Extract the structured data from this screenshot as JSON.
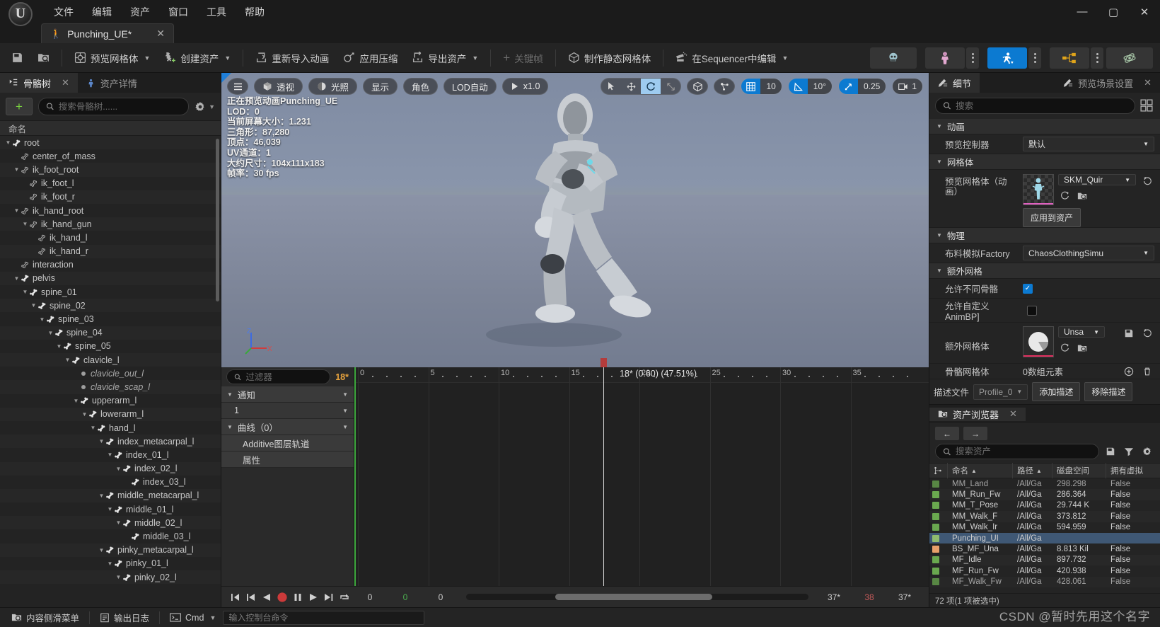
{
  "window": {
    "menus": [
      "文件",
      "编辑",
      "资产",
      "窗口",
      "工具",
      "帮助"
    ],
    "minimize": "—",
    "maximize": "▢",
    "close": "✕"
  },
  "tab": {
    "title": "Punching_UE*",
    "close": "✕"
  },
  "toolbar": {
    "save": "save-icon",
    "browse": "browse-icon",
    "items": [
      {
        "label": "预览网格体",
        "icon": "preview-mesh-icon",
        "caret": true
      },
      {
        "label": "创建资产",
        "icon": "create-asset-icon",
        "caret": true
      },
      {
        "label": "重新导入动画",
        "icon": "reimport-icon",
        "caret": false
      },
      {
        "label": "应用压缩",
        "icon": "compression-icon",
        "caret": false
      },
      {
        "label": "导出资产",
        "icon": "export-icon",
        "caret": true
      },
      {
        "label": "关键帧",
        "icon": "keyframe-icon",
        "caret": false,
        "disabled": true
      },
      {
        "label": "制作静态网格体",
        "icon": "static-mesh-icon",
        "caret": false
      },
      {
        "label": "在Sequencer中编辑",
        "icon": "sequencer-icon",
        "caret": true
      }
    ],
    "right_buttons": [
      {
        "name": "skeleton-mode-button",
        "icon": "skull-icon",
        "active": false
      },
      {
        "name": "mesh-mode-button",
        "icon": "body-icon",
        "active": false
      },
      {
        "name": "animation-mode-button",
        "icon": "runner-star-icon",
        "active": true
      },
      {
        "name": "graph-mode-button",
        "icon": "node-graph-icon",
        "active": false
      },
      {
        "name": "physics-mode-button",
        "icon": "physics-icon",
        "active": false
      }
    ]
  },
  "left_panel": {
    "tabs": [
      {
        "label": "骨骼树",
        "icon": "skeleton-tree-icon",
        "active": true,
        "close": "✕"
      },
      {
        "label": "资产详情",
        "icon": "asset-details-icon",
        "active": false
      }
    ],
    "add_button": "+",
    "search_placeholder": "搜索骨骼树......",
    "column_header": "命名",
    "tree": [
      {
        "label": "root",
        "depth": 0,
        "expand": "▼",
        "icon": "bone",
        "virtual": false
      },
      {
        "label": "center_of_mass",
        "depth": 1,
        "expand": "",
        "icon": "bone-small",
        "virtual": false
      },
      {
        "label": "ik_foot_root",
        "depth": 1,
        "expand": "▼",
        "icon": "bone-small",
        "virtual": false
      },
      {
        "label": "ik_foot_l",
        "depth": 2,
        "expand": "",
        "icon": "bone-small",
        "virtual": false
      },
      {
        "label": "ik_foot_r",
        "depth": 2,
        "expand": "",
        "icon": "bone-small",
        "virtual": false
      },
      {
        "label": "ik_hand_root",
        "depth": 1,
        "expand": "▼",
        "icon": "bone-small",
        "virtual": false
      },
      {
        "label": "ik_hand_gun",
        "depth": 2,
        "expand": "▼",
        "icon": "bone-small",
        "virtual": false
      },
      {
        "label": "ik_hand_l",
        "depth": 3,
        "expand": "",
        "icon": "bone-small",
        "virtual": false
      },
      {
        "label": "ik_hand_r",
        "depth": 3,
        "expand": "",
        "icon": "bone-small",
        "virtual": false
      },
      {
        "label": "interaction",
        "depth": 1,
        "expand": "",
        "icon": "bone-small",
        "virtual": false
      },
      {
        "label": "pelvis",
        "depth": 1,
        "expand": "▼",
        "icon": "bone",
        "virtual": false
      },
      {
        "label": "spine_01",
        "depth": 2,
        "expand": "▼",
        "icon": "bone",
        "virtual": false
      },
      {
        "label": "spine_02",
        "depth": 3,
        "expand": "▼",
        "icon": "bone",
        "virtual": false
      },
      {
        "label": "spine_03",
        "depth": 4,
        "expand": "▼",
        "icon": "bone",
        "virtual": false
      },
      {
        "label": "spine_04",
        "depth": 5,
        "expand": "▼",
        "icon": "bone",
        "virtual": false
      },
      {
        "label": "spine_05",
        "depth": 6,
        "expand": "▼",
        "icon": "bone",
        "virtual": false
      },
      {
        "label": "clavicle_l",
        "depth": 7,
        "expand": "▼",
        "icon": "bone",
        "virtual": false
      },
      {
        "label": "clavicle_out_l",
        "depth": 8,
        "expand": "",
        "icon": "dot",
        "virtual": true
      },
      {
        "label": "clavicle_scap_l",
        "depth": 8,
        "expand": "",
        "icon": "dot",
        "virtual": true
      },
      {
        "label": "upperarm_l",
        "depth": 8,
        "expand": "▼",
        "icon": "bone",
        "virtual": false
      },
      {
        "label": "lowerarm_l",
        "depth": 9,
        "expand": "▼",
        "icon": "bone",
        "virtual": false
      },
      {
        "label": "hand_l",
        "depth": 10,
        "expand": "▼",
        "icon": "bone",
        "virtual": false
      },
      {
        "label": "index_metacarpal_l",
        "depth": 11,
        "expand": "▼",
        "icon": "bone",
        "virtual": false
      },
      {
        "label": "index_01_l",
        "depth": 12,
        "expand": "▼",
        "icon": "bone",
        "virtual": false
      },
      {
        "label": "index_02_l",
        "depth": 13,
        "expand": "▼",
        "icon": "bone",
        "virtual": false
      },
      {
        "label": "index_03_l",
        "depth": 14,
        "expand": "",
        "icon": "bone",
        "virtual": false
      },
      {
        "label": "middle_metacarpal_l",
        "depth": 11,
        "expand": "▼",
        "icon": "bone",
        "virtual": false
      },
      {
        "label": "middle_01_l",
        "depth": 12,
        "expand": "▼",
        "icon": "bone",
        "virtual": false
      },
      {
        "label": "middle_02_l",
        "depth": 13,
        "expand": "▼",
        "icon": "bone",
        "virtual": false
      },
      {
        "label": "middle_03_l",
        "depth": 14,
        "expand": "",
        "icon": "bone",
        "virtual": false
      },
      {
        "label": "pinky_metacarpal_l",
        "depth": 11,
        "expand": "▼",
        "icon": "bone",
        "virtual": false
      },
      {
        "label": "pinky_01_l",
        "depth": 12,
        "expand": "▼",
        "icon": "bone",
        "virtual": false
      },
      {
        "label": "pinky_02_l",
        "depth": 13,
        "expand": "▼",
        "icon": "bone",
        "virtual": false
      }
    ]
  },
  "viewport": {
    "toolbar": {
      "menu_icon": "hamburger-icon",
      "view_mode": "透视",
      "lighting": "光照",
      "show": "显示",
      "character": "角色",
      "lod": "LOD自动",
      "speed": "x1.0",
      "transforms": [
        "select-arrow-icon",
        "move-icon",
        "rotate-icon",
        "scale-icon"
      ],
      "coord_icons": [
        "world-space-icon",
        "local-space-icon"
      ],
      "grid_snap": "10",
      "angle_snap": "10°",
      "scale_snap": "0.25",
      "camera_speed": "1"
    },
    "stats": [
      "正在预览动画Punching_UE",
      "LOD：0",
      "当前屏幕大小：1.231",
      "三角形：87,280",
      "顶点：46,039",
      "UV通道：1",
      "大约尺寸：104x111x183",
      "帧率：30 fps"
    ],
    "axis": {
      "z": "Z",
      "x": "X",
      "y": "Y"
    }
  },
  "timeline": {
    "filter_placeholder": "过滤器",
    "frame_badge": "18*",
    "tracks": [
      {
        "label": "通知",
        "type": "group"
      },
      {
        "label": "1",
        "type": "sub"
      },
      {
        "label": "曲线（0）",
        "type": "group"
      },
      {
        "label": "Additive图层轨道",
        "type": "plain"
      },
      {
        "label": "属性",
        "type": "plain"
      }
    ],
    "header_label": "18* (0.60) (47.51%)",
    "ruler_ticks": [
      "0",
      "5",
      "10",
      "15",
      "20",
      "25",
      "30",
      "35"
    ],
    "transport": {
      "buttons": [
        "skip-to-start-icon",
        "step-back-icon",
        "play-reverse-icon",
        "record-icon",
        "pause-icon",
        "play-forward-icon",
        "step-forward-icon",
        "loop-icon"
      ],
      "fields": [
        "0",
        "0",
        "0"
      ],
      "right_fields": [
        "37*",
        "38",
        "37*"
      ]
    }
  },
  "details": {
    "tabs": [
      {
        "label": "细节",
        "icon": "details-icon",
        "active": true
      },
      {
        "label": "预览场景设置",
        "icon": "preview-scene-icon",
        "active": false,
        "close": "✕"
      }
    ],
    "search_placeholder": "搜索",
    "sections": [
      {
        "title": "动画",
        "rows": [
          {
            "key": "预览控制器",
            "type": "combo",
            "value": "默认"
          }
        ]
      },
      {
        "title": "网格体",
        "rows": [
          {
            "key": "预览网格体（动画）",
            "type": "asset",
            "value": "SKM_Quir",
            "button": "应用到资产"
          }
        ]
      },
      {
        "title": "物理",
        "rows": [
          {
            "key": "布料模拟Factory",
            "type": "combo",
            "value": "ChaosClothingSimu"
          }
        ]
      },
      {
        "title": "额外网格",
        "rows": [
          {
            "key": "允许不同骨骼",
            "type": "check",
            "checked": true
          },
          {
            "key": "允许自定义AnimBP]",
            "type": "check",
            "checked": false
          },
          {
            "key": "额外网格体",
            "type": "asset2",
            "value": "Unsa"
          },
          {
            "key": "骨骼网格体",
            "type": "array",
            "value": "0数组元素"
          }
        ]
      }
    ],
    "profile_row": {
      "label": "描述文件",
      "combo_value": "Profile_0",
      "add_button": "添加描述",
      "remove_button": "移除描述"
    }
  },
  "asset_browser": {
    "tab_label": "资产浏览器",
    "tab_icon": "asset-browser-icon",
    "tab_close": "✕",
    "back": "←",
    "forward": "→",
    "search_placeholder": "搜索资产",
    "columns": [
      "命名",
      "路径",
      "磁盘空间",
      "拥有虚拟"
    ],
    "sort_col": "命名",
    "rows": [
      {
        "name": "MM_Land",
        "path": "/All/Ga",
        "size": "298.298",
        "virtual": "False",
        "type": "anim",
        "selected": false,
        "partial": true
      },
      {
        "name": "MM_Run_Fw",
        "path": "/All/Ga",
        "size": "286.364",
        "virtual": "False",
        "type": "anim",
        "selected": false
      },
      {
        "name": "MM_T_Pose",
        "path": "/All/Ga",
        "size": "29.744 K",
        "virtual": "False",
        "type": "anim",
        "selected": false
      },
      {
        "name": "MM_Walk_F",
        "path": "/All/Ga",
        "size": "373.812",
        "virtual": "False",
        "type": "anim",
        "selected": false
      },
      {
        "name": "MM_Walk_Ir",
        "path": "/All/Ga",
        "size": "594.959",
        "virtual": "False",
        "type": "anim",
        "selected": false
      },
      {
        "name": "Punching_UI",
        "path": "/All/Ga",
        "size": "",
        "virtual": "",
        "type": "anim-sel",
        "selected": true
      },
      {
        "name": "BS_MF_Una",
        "path": "/All/Ga",
        "size": "8.813 Kil",
        "virtual": "False",
        "type": "blend",
        "selected": false
      },
      {
        "name": "MF_Idle",
        "path": "/All/Ga",
        "size": "897.732",
        "virtual": "False",
        "type": "anim",
        "selected": false
      },
      {
        "name": "MF_Run_Fw",
        "path": "/All/Ga",
        "size": "420.938",
        "virtual": "False",
        "type": "anim",
        "selected": false
      },
      {
        "name": "MF_Walk_Fw",
        "path": "/All/Ga",
        "size": "428.061",
        "virtual": "False",
        "type": "anim",
        "selected": false,
        "partial": true
      }
    ],
    "status": "72 项(1 项被选中)"
  },
  "statusbar": {
    "items": [
      {
        "label": "内容侧滑菜单",
        "icon": "content-drawer-icon"
      },
      {
        "label": "输出日志",
        "icon": "output-log-icon"
      },
      {
        "label": "Cmd",
        "icon": "cmd-icon",
        "caret": true
      }
    ],
    "cmd_placeholder": "输入控制台命令"
  },
  "watermark": "CSDN @暂时先用这个名字"
}
